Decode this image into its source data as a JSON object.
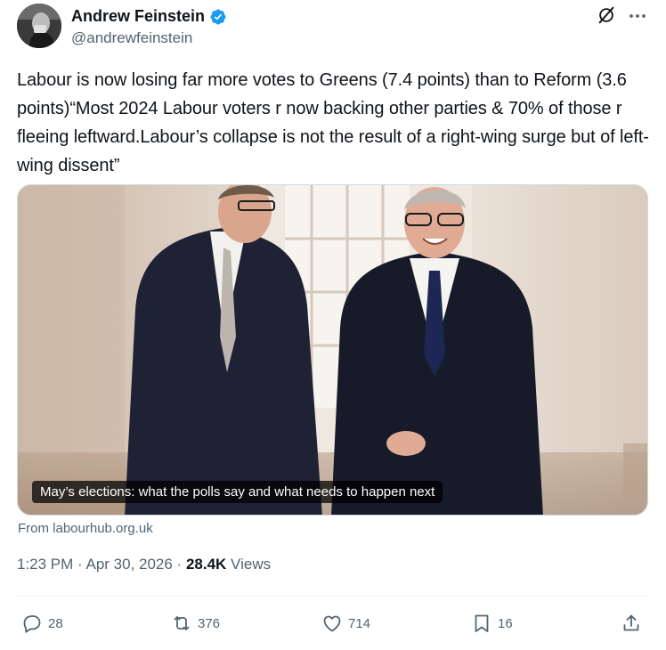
{
  "tweet": {
    "author_name": "Andrew Feinstein",
    "handle": "@andrewfeinstein",
    "text": "Labour is now losing far more votes to Greens (7.4 points) than to Reform (3.6 points)“Most 2024 Labour voters r now backing other parties & 70% of those r fleeing leftward.Labour’s collapse is not the result of a right-wing surge but of left-wing dissent”",
    "card": {
      "caption": "May’s elections: what the polls say and what needs to happen next",
      "source": "From labourhub.org.uk"
    },
    "time": "1:23 PM · Apr 30, 2026 · ",
    "views_count": "28.4K",
    "views_label": " Views"
  },
  "actions": {
    "replies": "28",
    "reposts": "376",
    "likes": "714",
    "bookmarks": "16"
  },
  "colors": {
    "verified": "#1d9bf0",
    "secondary_text": "#536471"
  }
}
